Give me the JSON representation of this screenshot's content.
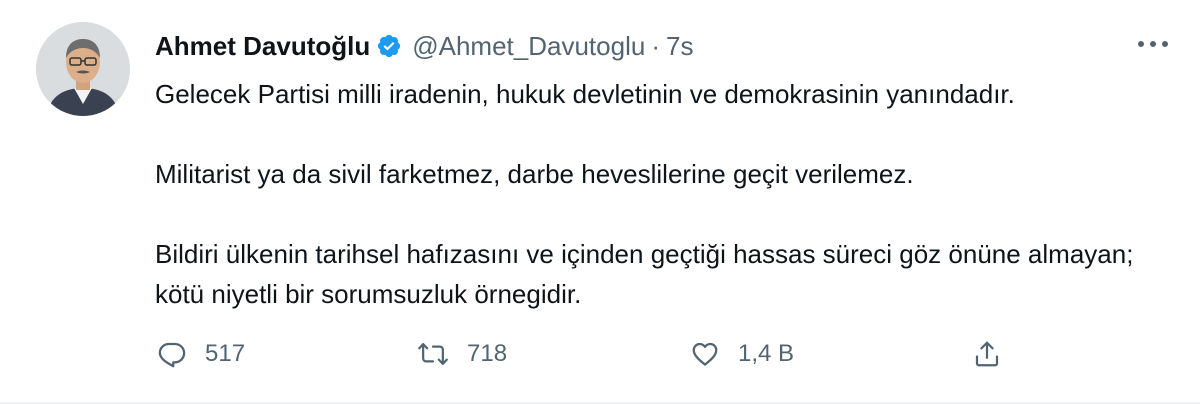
{
  "tweet": {
    "author": {
      "display_name": "Ahmet Davutoğlu",
      "handle": "@Ahmet_Davutoglu",
      "verified": true,
      "verified_icon": "verified-badge-icon",
      "avatar": "profile-photo"
    },
    "separator": "·",
    "time": "7s",
    "paragraphs": [
      "Gelecek Partisi milli iradenin, hukuk devletinin ve demokrasinin yanındadır.",
      "Militarist ya da sivil farketmez, darbe heveslilerine geçit verilemez.",
      "Bildiri ülkenin tarihsel hafızasını ve içinden geçtiği hassas süreci göz önüne almayan; kötü niyetli bir sorumsuzluk örnegidir."
    ],
    "actions": {
      "reply": {
        "icon": "reply-icon",
        "count": "517"
      },
      "retweet": {
        "icon": "retweet-icon",
        "count": "718"
      },
      "like": {
        "icon": "heart-icon",
        "count": "1,4 B"
      },
      "share": {
        "icon": "share-icon"
      }
    },
    "more_icon": "more-options-icon"
  },
  "colors": {
    "text_primary": "#0f1419",
    "text_secondary": "#536471",
    "verified_blue": "#1d9bf0"
  }
}
